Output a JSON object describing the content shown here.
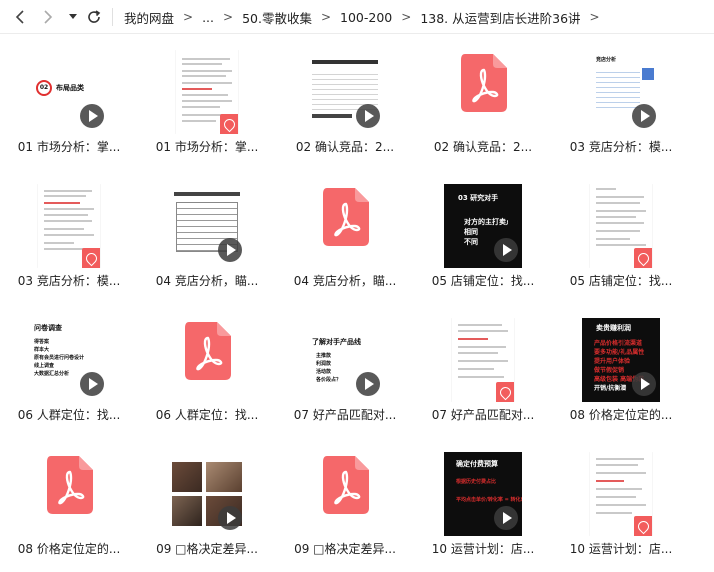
{
  "toolbar": {
    "back_icon": "chevron-left-icon",
    "forward_icon": "chevron-right-icon",
    "history_icon": "caret-down-icon",
    "refresh_icon": "refresh-icon"
  },
  "breadcrumb": [
    "我的网盘",
    "...",
    "50.零散收集",
    "100-200",
    "138. 从运营到店长进阶36讲"
  ],
  "files": [
    {
      "label": "01 市场分析：掌...",
      "kind": "video",
      "slide": {
        "num": "02",
        "title": "布局品类"
      }
    },
    {
      "label": "01 市场分析：掌...",
      "kind": "doc"
    },
    {
      "label": "02 确认竞品：2...",
      "kind": "video"
    },
    {
      "label": "02 确认竞品：2...",
      "kind": "pdf"
    },
    {
      "label": "03 竞店分析：模...",
      "kind": "video",
      "slide": {
        "title": "竞店分析"
      }
    },
    {
      "label": "03 竞店分析：模...",
      "kind": "doc"
    },
    {
      "label": "04 竞店分析，瞄...",
      "kind": "video"
    },
    {
      "label": "04 竞店分析，瞄...",
      "kind": "pdf"
    },
    {
      "label": "05 店铺定位：找...",
      "kind": "video",
      "slide": {
        "title": "03 研究对手",
        "lines": [
          "对方的主打卖点",
          "相同",
          "不同"
        ]
      }
    },
    {
      "label": "05 店铺定位：找...",
      "kind": "doc"
    },
    {
      "label": "06 人群定位：找...",
      "kind": "video",
      "slide": {
        "title": "问卷调查",
        "lines": [
          "得答案",
          "样本大",
          "原有会员进行问卷设计",
          "线上调查",
          "大数据汇总分析"
        ]
      }
    },
    {
      "label": "06 人群定位：找...",
      "kind": "pdf"
    },
    {
      "label": "07 好产品匹配对...",
      "kind": "video",
      "slide": {
        "title": "了解对手产品线",
        "lines": [
          "主推款",
          "利润款",
          "活动款",
          "各价段占？"
        ]
      }
    },
    {
      "label": "07 好产品匹配对...",
      "kind": "doc"
    },
    {
      "label": "08 价格定位定的...",
      "kind": "video",
      "slide": {
        "title": "卖贵赚利润",
        "lines": [
          "产品价格引流渠道",
          "要多功能/礼品属性",
          "提升用户体验",
          "做节假促销",
          "高级包装 高端伪装",
          "开销/抗衡潜"
        ]
      }
    },
    {
      "label": "08 价格定位定的...",
      "kind": "pdf"
    },
    {
      "label": "09 □格决定差异...",
      "kind": "video"
    },
    {
      "label": "09 □格决定差异...",
      "kind": "pdf"
    },
    {
      "label": "10 运营计划：店...",
      "kind": "video",
      "slide": {
        "title": "确定付费预算",
        "lines": [
          "根据历史付费占比",
          "平均点击单价/转化率 = 转化成本"
        ]
      }
    },
    {
      "label": "10 运营计划：店...",
      "kind": "doc"
    }
  ],
  "colors": {
    "accent": "#f25c5c",
    "play": "#3c3c3c",
    "red_text": "#d82d2d"
  }
}
